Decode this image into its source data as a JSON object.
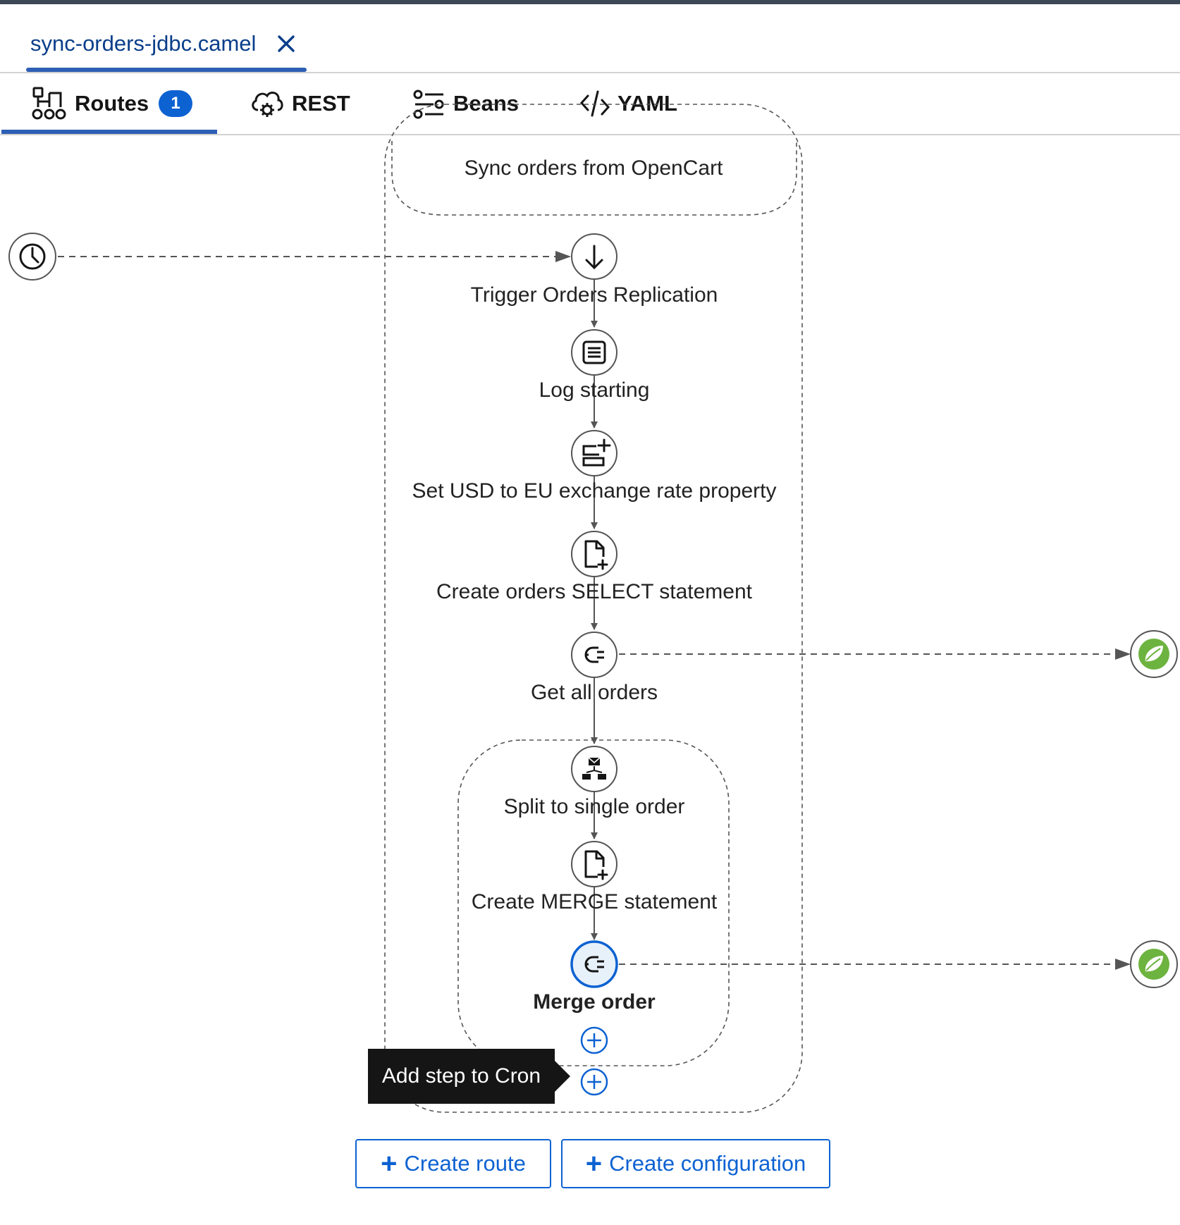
{
  "file_tab": {
    "name": "sync-orders-jdbc.camel"
  },
  "tabs": {
    "routes": {
      "label": "Routes",
      "badge": "1"
    },
    "rest": {
      "label": "REST"
    },
    "beans": {
      "label": "Beans"
    },
    "yaml": {
      "label": "YAML"
    }
  },
  "route": {
    "title": "Sync orders from OpenCart",
    "steps": [
      {
        "label": "Trigger Orders Replication",
        "icon": "arrow-down-icon"
      },
      {
        "label": "Log starting",
        "icon": "log-icon"
      },
      {
        "label": "Set USD to EU exchange rate property",
        "icon": "set-property-icon"
      },
      {
        "label": "Create orders SELECT statement",
        "icon": "document-plus-icon"
      },
      {
        "label": "Get all orders",
        "icon": "plug-icon"
      },
      {
        "label": "Split to single order",
        "icon": "splitter-icon"
      },
      {
        "label": "Create MERGE statement",
        "icon": "document-plus-icon"
      },
      {
        "label": "Merge order",
        "icon": "plug-icon",
        "selected": true
      }
    ]
  },
  "tooltip": {
    "text": "Add step to Cron"
  },
  "buttons": {
    "create_route": "Create route",
    "create_configuration": "Create configuration"
  },
  "colors": {
    "accent": "#0d62d2",
    "tab_underline": "#2d5fb4",
    "spring_green": "#6db33f",
    "selected_fill": "#e7f1fa"
  }
}
